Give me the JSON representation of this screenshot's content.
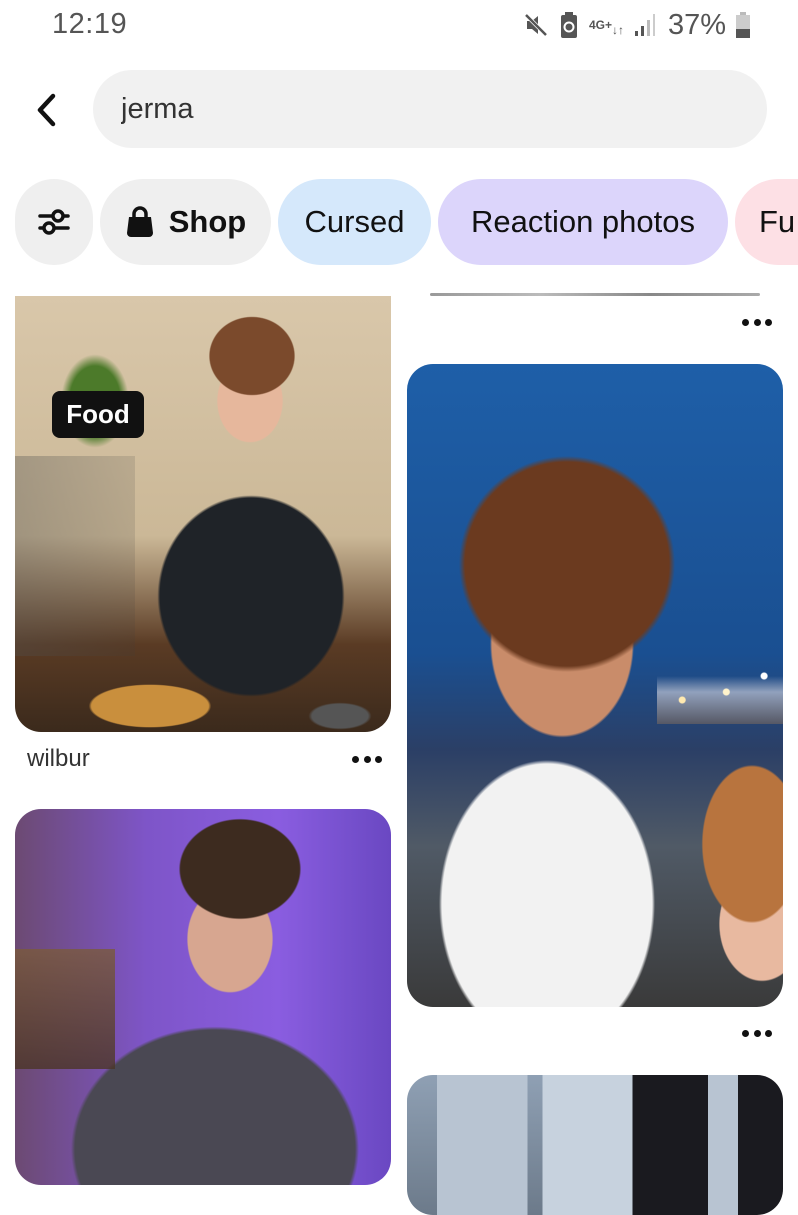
{
  "status_bar": {
    "time": "12:19",
    "icons": [
      "mute-icon",
      "battery-saver-icon",
      "4g-plus-data-icon",
      "signal-icon",
      "battery-icon"
    ],
    "network_label": "4G+",
    "battery_percent": "37%"
  },
  "search": {
    "back_icon": "chevron-left-icon",
    "query": "jerma"
  },
  "chips": [
    {
      "label": "",
      "icon": "filter-sliders-icon"
    },
    {
      "label": "Shop",
      "icon": "shopping-bag-icon"
    },
    {
      "label": "Cursed",
      "color": "#d5e8fb"
    },
    {
      "label": "Reaction photos",
      "color": "#dcd5fb"
    },
    {
      "label": "Fu",
      "color": "#fde0e5"
    }
  ],
  "feed": {
    "pins": [
      {
        "column": "right",
        "title": "",
        "more_icon": "more-horizontal-icon",
        "partial": true
      },
      {
        "column": "left",
        "badge": "Food",
        "title": "wilbur",
        "more_icon": "more-horizontal-icon"
      },
      {
        "column": "right",
        "title": "",
        "more_icon": "more-horizontal-icon"
      },
      {
        "column": "left",
        "title": ""
      },
      {
        "column": "right",
        "title": ""
      }
    ]
  }
}
